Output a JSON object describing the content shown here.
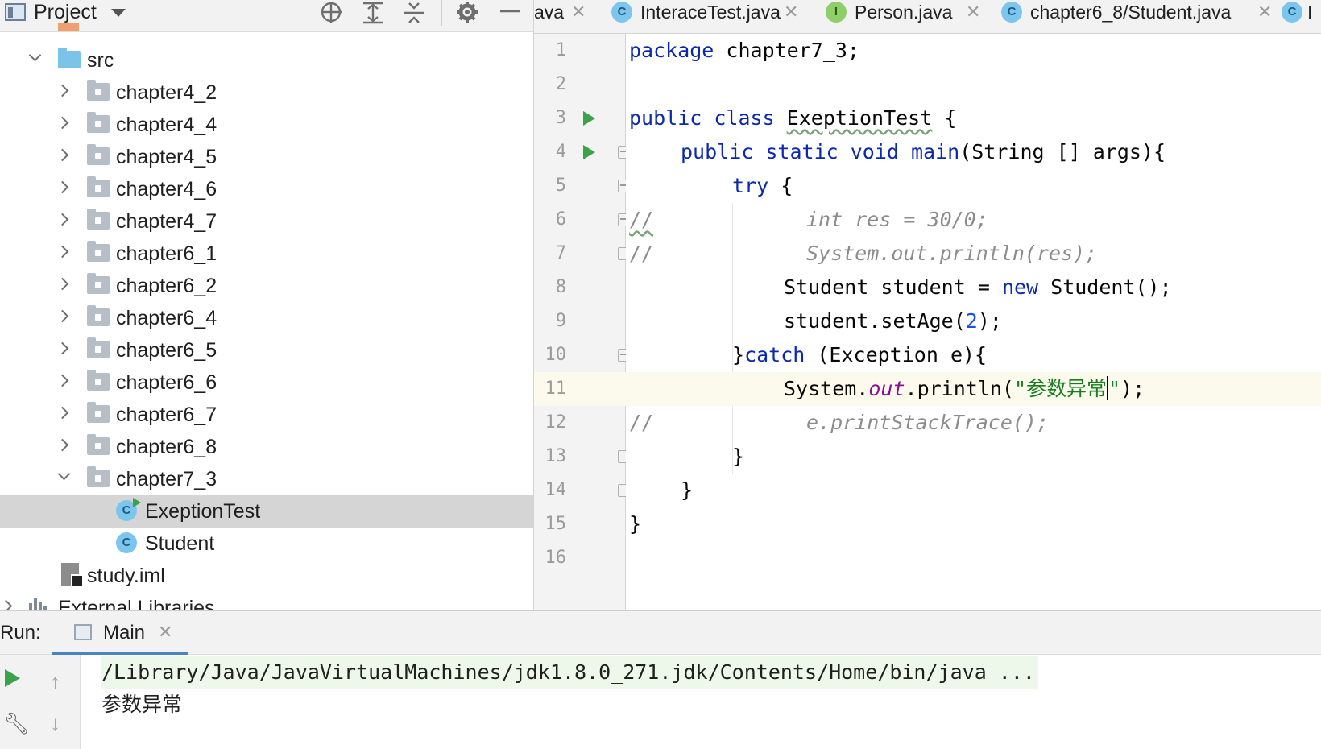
{
  "project": {
    "title": "Project",
    "tree": [
      {
        "label": "src",
        "kind": "src",
        "expanded": true
      },
      {
        "label": "chapter4_2",
        "kind": "package"
      },
      {
        "label": "chapter4_4",
        "kind": "package"
      },
      {
        "label": "chapter4_5",
        "kind": "package"
      },
      {
        "label": "chapter4_6",
        "kind": "package"
      },
      {
        "label": "chapter4_7",
        "kind": "package"
      },
      {
        "label": "chapter6_1",
        "kind": "package"
      },
      {
        "label": "chapter6_2",
        "kind": "package"
      },
      {
        "label": "chapter6_4",
        "kind": "package"
      },
      {
        "label": "chapter6_5",
        "kind": "package"
      },
      {
        "label": "chapter6_6",
        "kind": "package"
      },
      {
        "label": "chapter6_7",
        "kind": "package"
      },
      {
        "label": "chapter6_8",
        "kind": "package"
      },
      {
        "label": "chapter7_3",
        "kind": "package",
        "expanded": true
      },
      {
        "label": "ExeptionTest",
        "kind": "class",
        "selected": true
      },
      {
        "label": "Student",
        "kind": "class"
      },
      {
        "label": "study.iml",
        "kind": "iml"
      },
      {
        "label": "External Libraries",
        "kind": "library"
      }
    ]
  },
  "tabs": [
    {
      "label": "ava",
      "icon": "none"
    },
    {
      "label": "InteraceTest.java",
      "icon": "class-runnable-icon",
      "letter": "C"
    },
    {
      "label": "Person.java",
      "icon": "interface-icon",
      "letter": "I"
    },
    {
      "label": "chapter6_8/Student.java",
      "icon": "class-icon",
      "letter": "C"
    },
    {
      "label": "I",
      "icon": "class-icon",
      "letter": "C"
    }
  ],
  "editor": {
    "current_line": 11,
    "line_numbers": [
      "1",
      "2",
      "3",
      "4",
      "5",
      "6",
      "7",
      "8",
      "9",
      "10",
      "11",
      "12",
      "13",
      "14",
      "15",
      "16"
    ],
    "lines": [
      "package chapter7_3;",
      "",
      "public class ExeptionTest {",
      "    public static void main(String [] args){",
      "        try {",
      "//          int res = 30/0;",
      "//          System.out.println(res);",
      "            Student student = new Student();",
      "            student.setAge(2);",
      "        }catch (Exception e){",
      "            System.out.println(\"参数异常\");",
      "//          e.printStackTrace();",
      "        }",
      "    }",
      "}",
      ""
    ]
  },
  "run": {
    "label": "Run:",
    "tab_label": "Main",
    "console": [
      "/Library/Java/JavaVirtualMachines/jdk1.8.0_271.jdk/Contents/Home/bin/java ...",
      "参数异常"
    ]
  },
  "colors": {
    "keyword": "#0c28b0",
    "string": "#167d1d",
    "comment": "#8c8c8c",
    "number": "#1750eb",
    "static_field": "#871094",
    "run_marker": "#3aa34a",
    "selection": "#d5d5d5",
    "current_line": "#fcfaed"
  }
}
